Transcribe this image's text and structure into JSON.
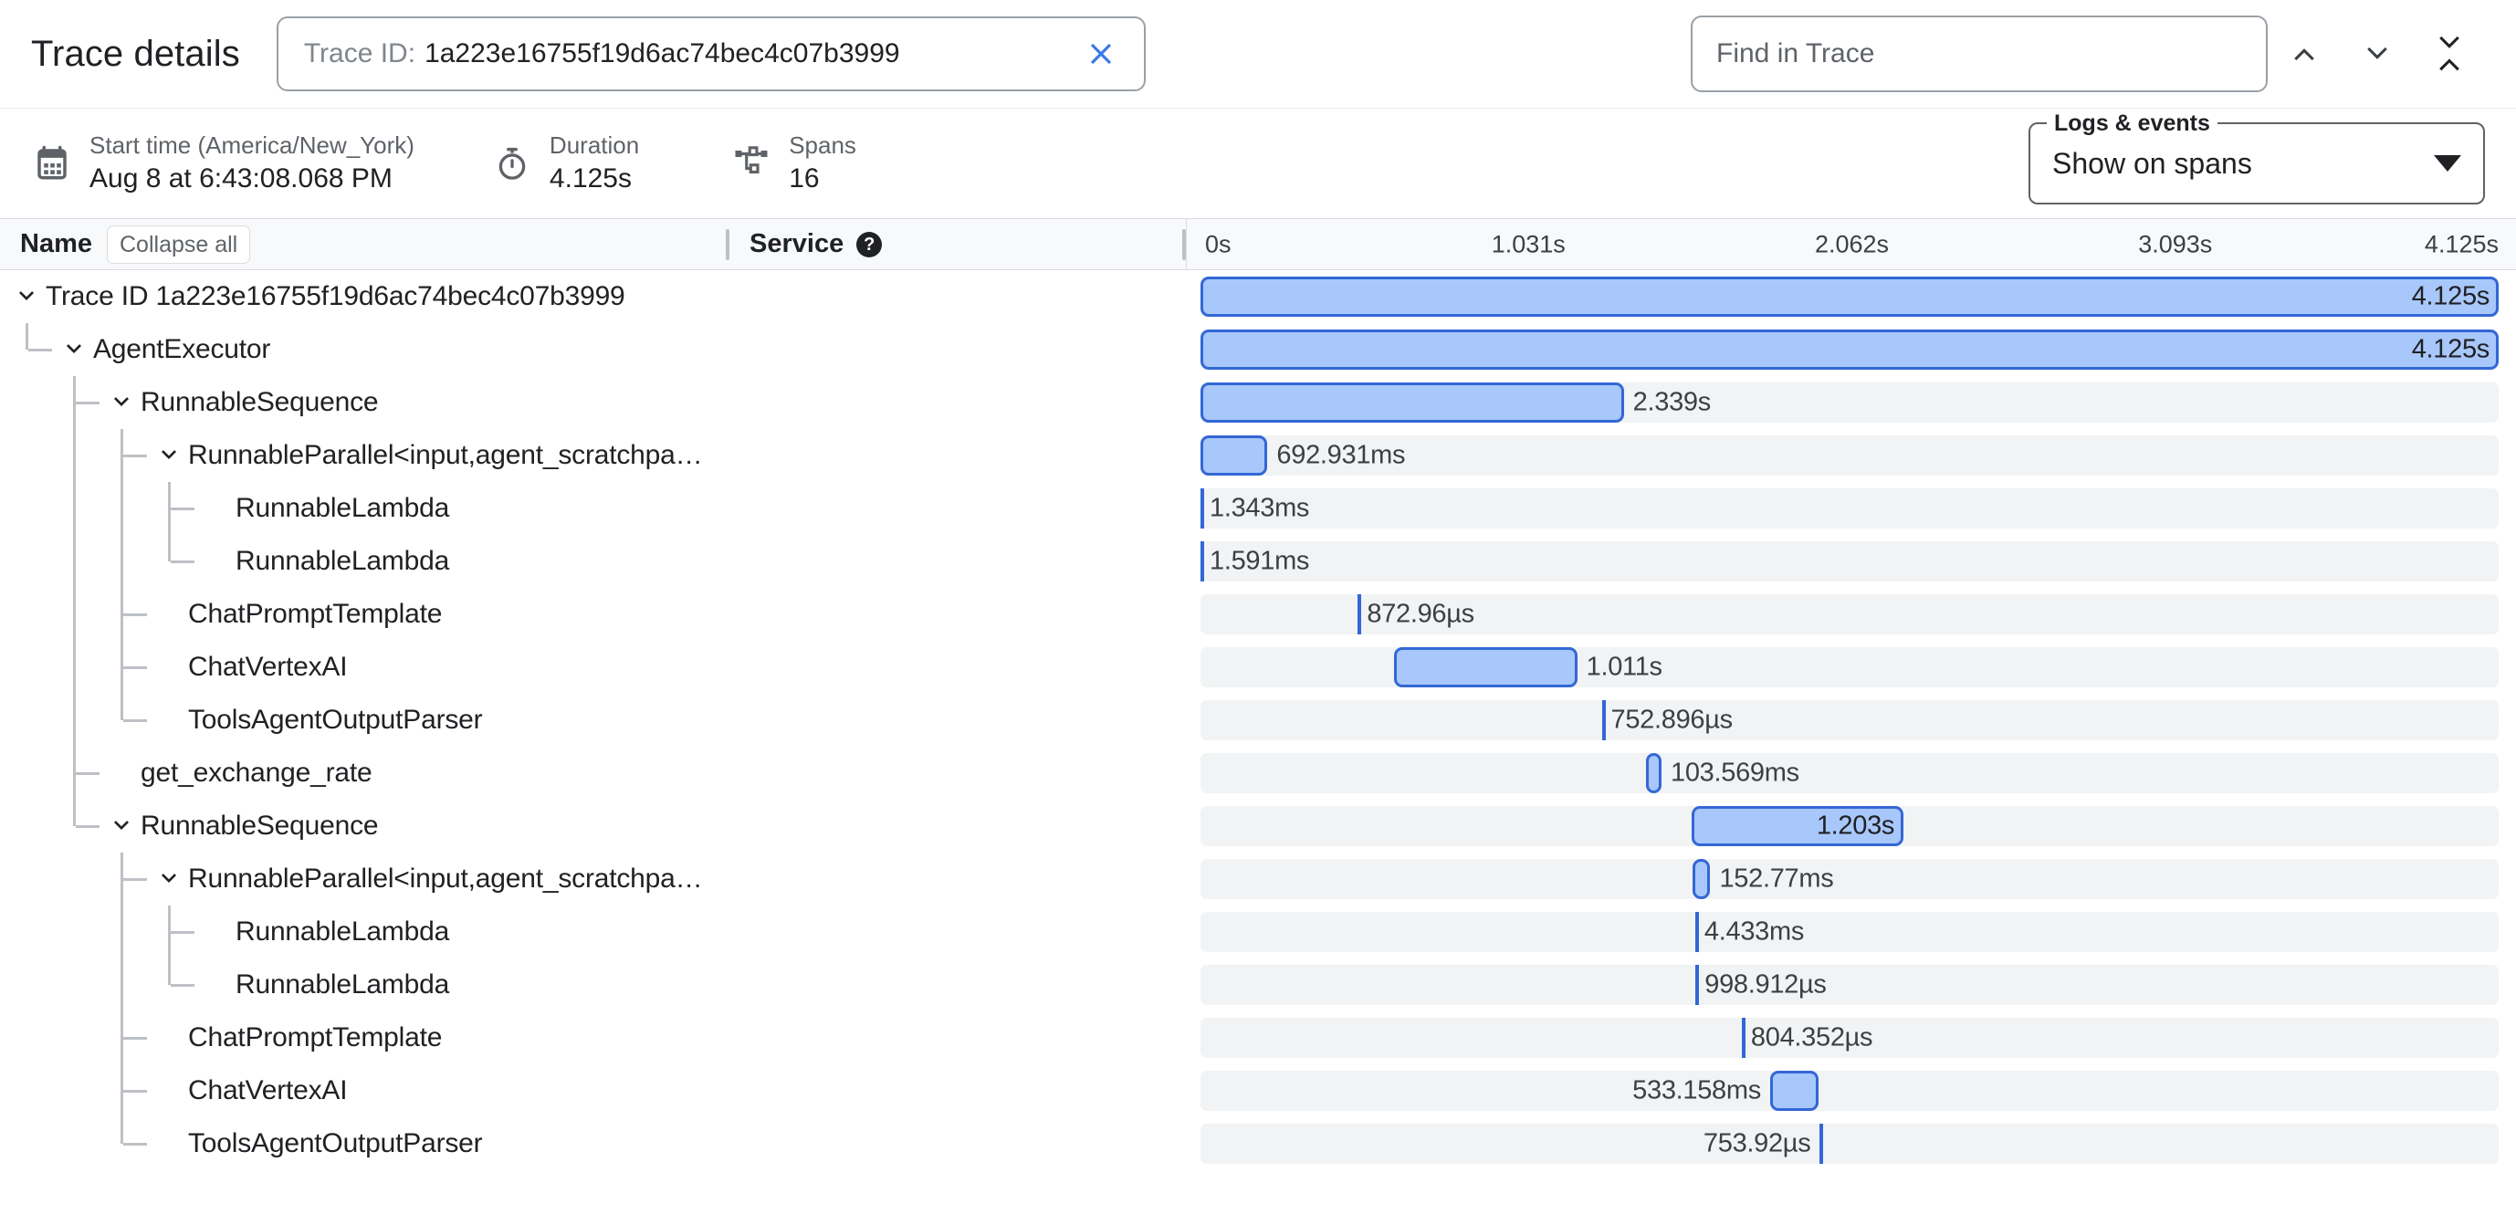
{
  "header": {
    "title": "Trace details",
    "trace_id_label": "Trace ID:",
    "trace_id_value": "1a223e16755f19d6ac74bec4c07b3999",
    "clear_icon": "close-x-icon",
    "find_placeholder": "Find in Trace",
    "find_value": "",
    "prev_icon": "chevron-up-icon",
    "next_icon": "chevron-down-icon",
    "collapse_icon": "collapse-all-icon"
  },
  "meta": {
    "start_time_label": "Start time (America/New_York)",
    "start_time_value": "Aug 8 at 6:43:08.068 PM",
    "start_time_icon": "calendar-icon",
    "duration_label": "Duration",
    "duration_value": "4.125s",
    "duration_icon": "stopwatch-icon",
    "spans_label": "Spans",
    "spans_value": "16",
    "spans_icon": "span-tree-icon",
    "logs_legend": "Logs & events",
    "logs_value": "Show on spans",
    "logs_arrow_icon": "dropdown-arrow-icon"
  },
  "columns": {
    "name": "Name",
    "collapse_all": "Collapse all",
    "service": "Service",
    "service_help_icon": "help-icon"
  },
  "timeline": {
    "total_duration_s": 4.125,
    "ticks": [
      "0s",
      "1.031s",
      "2.062s",
      "3.093s",
      "4.125s"
    ]
  },
  "spans": [
    {
      "name": "Trace ID 1a223e16755f19d6ac74bec4c07b3999",
      "depth": 0,
      "expandable": true,
      "expanded": true,
      "duration": "4.125s",
      "start_s": 0.0,
      "dur_s": 4.125,
      "label_pos": "inside-right"
    },
    {
      "name": "AgentExecutor",
      "depth": 1,
      "expandable": true,
      "expanded": true,
      "duration": "4.125s",
      "start_s": 0.0,
      "dur_s": 4.125,
      "label_pos": "inside-right"
    },
    {
      "name": "RunnableSequence",
      "depth": 2,
      "expandable": true,
      "expanded": true,
      "duration": "2.339s",
      "start_s": 0.0,
      "dur_s": 1.345,
      "label_pos": "right"
    },
    {
      "name": "RunnableParallel<input,agent_scratchpa…",
      "depth": 3,
      "expandable": true,
      "expanded": true,
      "duration": "692.931ms",
      "start_s": 0.0,
      "dur_s": 0.213,
      "label_pos": "right"
    },
    {
      "name": "RunnableLambda",
      "depth": 4,
      "expandable": false,
      "expanded": false,
      "duration": "1.343ms",
      "start_s": 0.0,
      "dur_s": 0.0,
      "label_pos": "right",
      "thin": true
    },
    {
      "name": "RunnableLambda",
      "depth": 4,
      "expandable": false,
      "expanded": false,
      "duration": "1.591ms",
      "start_s": 0.0,
      "dur_s": 0.0,
      "label_pos": "right",
      "thin": true
    },
    {
      "name": "ChatPromptTemplate",
      "depth": 3,
      "expandable": false,
      "expanded": false,
      "duration": "872.96µs",
      "start_s": 0.5,
      "dur_s": 0.0,
      "label_pos": "right",
      "thin": true
    },
    {
      "name": "ChatVertexAI",
      "depth": 3,
      "expandable": false,
      "expanded": false,
      "duration": "1.011s",
      "start_s": 0.615,
      "dur_s": 0.582,
      "label_pos": "right"
    },
    {
      "name": "ToolsAgentOutputParser",
      "depth": 3,
      "expandable": false,
      "expanded": false,
      "duration": "752.896µs",
      "start_s": 1.275,
      "dur_s": 0.0,
      "label_pos": "right",
      "thin": true
    },
    {
      "name": "get_exchange_rate",
      "depth": 2,
      "expandable": false,
      "expanded": false,
      "duration": "103.569ms",
      "start_s": 1.415,
      "dur_s": 0.05,
      "label_pos": "right"
    },
    {
      "name": "RunnableSequence",
      "depth": 2,
      "expandable": true,
      "expanded": true,
      "duration": "1.203s",
      "start_s": 1.562,
      "dur_s": 0.672,
      "label_pos": "inside-right"
    },
    {
      "name": "RunnableParallel<input,agent_scratchpa…",
      "depth": 3,
      "expandable": true,
      "expanded": true,
      "duration": "152.77ms",
      "start_s": 1.565,
      "dur_s": 0.055,
      "label_pos": "right"
    },
    {
      "name": "RunnableLambda",
      "depth": 4,
      "expandable": false,
      "expanded": false,
      "duration": "4.433ms",
      "start_s": 1.572,
      "dur_s": 0.0,
      "label_pos": "right",
      "thin": true
    },
    {
      "name": "RunnableLambda",
      "depth": 4,
      "expandable": false,
      "expanded": false,
      "duration": "998.912µs",
      "start_s": 1.573,
      "dur_s": 0.0,
      "label_pos": "right",
      "thin": true
    },
    {
      "name": "ChatPromptTemplate",
      "depth": 3,
      "expandable": false,
      "expanded": false,
      "duration": "804.352µs",
      "start_s": 1.72,
      "dur_s": 0.0,
      "label_pos": "right",
      "thin": true
    },
    {
      "name": "ChatVertexAI",
      "depth": 3,
      "expandable": false,
      "expanded": false,
      "duration": "533.158ms",
      "start_s": 1.81,
      "dur_s": 0.155,
      "label_pos": "left"
    },
    {
      "name": "ToolsAgentOutputParser",
      "depth": 3,
      "expandable": false,
      "expanded": false,
      "duration": "753.92µs",
      "start_s": 1.968,
      "dur_s": 0.0,
      "label_pos": "left",
      "thin": true
    }
  ],
  "colors": {
    "bar_fill": "#a8c7fa",
    "bar_border": "#3367d6",
    "track": "#f1f3f4",
    "accent": "#1a73e8"
  }
}
